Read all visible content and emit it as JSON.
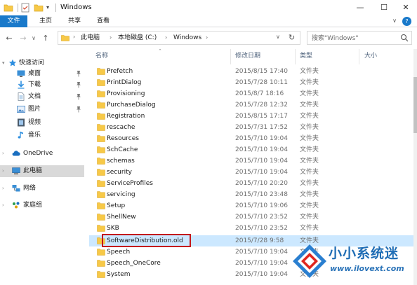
{
  "window": {
    "title": "Windows",
    "minimize": "—",
    "maximize": "☐",
    "close": "✕"
  },
  "ribbon": {
    "tabs": [
      "文件",
      "主页",
      "共享",
      "查看"
    ],
    "expand": "∨",
    "help": "?"
  },
  "nav": {
    "back": "←",
    "forward": "→",
    "recent": "∨",
    "up": "↑"
  },
  "address": {
    "crumbs": [
      "此电脑",
      "本地磁盘 (C:)",
      "Windows"
    ],
    "separator": "›",
    "dropdown": "∨",
    "refresh": "↻"
  },
  "search": {
    "placeholder": "搜索\"Windows\""
  },
  "sidebar": {
    "items": [
      {
        "label": "快速访问",
        "icon": "star-icon"
      },
      {
        "label": "桌面",
        "icon": "desktop-icon",
        "pinned": true
      },
      {
        "label": "下载",
        "icon": "download-icon",
        "pinned": true
      },
      {
        "label": "文档",
        "icon": "document-icon",
        "pinned": true
      },
      {
        "label": "图片",
        "icon": "pictures-icon",
        "pinned": true
      },
      {
        "label": "视频",
        "icon": "video-icon"
      },
      {
        "label": "音乐",
        "icon": "music-icon"
      },
      {
        "label": "OneDrive",
        "icon": "cloud-icon"
      },
      {
        "label": "此电脑",
        "icon": "computer-icon",
        "selected": true
      },
      {
        "label": "网络",
        "icon": "network-icon"
      },
      {
        "label": "家庭组",
        "icon": "homegroup-icon"
      }
    ]
  },
  "columns": {
    "name": "名称",
    "date": "修改日期",
    "type": "类型",
    "size": "大小"
  },
  "files": [
    {
      "name": "Prefetch",
      "date": "2015/8/15 17:40",
      "type": "文件夹"
    },
    {
      "name": "PrintDialog",
      "date": "2015/7/28 10:11",
      "type": "文件夹"
    },
    {
      "name": "Provisioning",
      "date": "2015/8/7 18:16",
      "type": "文件夹"
    },
    {
      "name": "PurchaseDialog",
      "date": "2015/7/28 12:32",
      "type": "文件夹"
    },
    {
      "name": "Registration",
      "date": "2015/8/15 17:17",
      "type": "文件夹"
    },
    {
      "name": "rescache",
      "date": "2015/7/31 17:52",
      "type": "文件夹"
    },
    {
      "name": "Resources",
      "date": "2015/7/10 19:04",
      "type": "文件夹"
    },
    {
      "name": "SchCache",
      "date": "2015/7/10 19:04",
      "type": "文件夹"
    },
    {
      "name": "schemas",
      "date": "2015/7/10 19:04",
      "type": "文件夹"
    },
    {
      "name": "security",
      "date": "2015/7/10 19:04",
      "type": "文件夹"
    },
    {
      "name": "ServiceProfiles",
      "date": "2015/7/10 20:20",
      "type": "文件夹"
    },
    {
      "name": "servicing",
      "date": "2015/7/10 23:48",
      "type": "文件夹"
    },
    {
      "name": "Setup",
      "date": "2015/7/10 19:06",
      "type": "文件夹"
    },
    {
      "name": "ShellNew",
      "date": "2015/7/10 23:52",
      "type": "文件夹"
    },
    {
      "name": "SKB",
      "date": "2015/7/10 23:52",
      "type": "文件夹"
    },
    {
      "name": "SoftwareDistribution.old",
      "date": "2015/7/28 9:58",
      "type": "文件夹",
      "selected": true
    },
    {
      "name": "Speech",
      "date": "2015/7/10 19:04",
      "type": "文件夹"
    },
    {
      "name": "Speech_OneCore",
      "date": "2015/7/10 19:04",
      "type": "文件夹"
    },
    {
      "name": "System",
      "date": "2015/7/10 19:04",
      "type": "文件夹"
    }
  ],
  "watermark": {
    "brand": "小小系统迷",
    "url": "www.ilovext.com"
  },
  "colors": {
    "accent": "#1979ca",
    "selection": "#cce8ff",
    "folder": "#f7c948",
    "highlight": "#c4161c"
  }
}
